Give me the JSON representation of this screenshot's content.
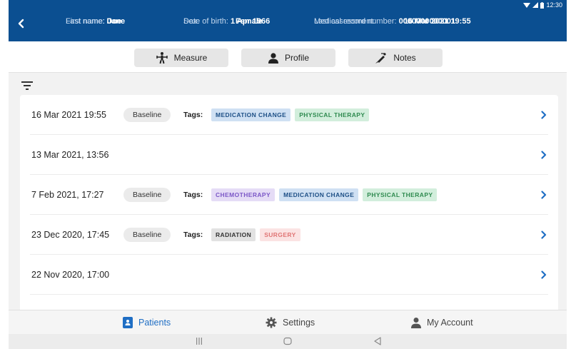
{
  "patient": {
    "first_name_label": "First name:",
    "first_name": "Jane",
    "last_name_label": "Last name:",
    "last_name": "Doe",
    "dob_label": "Date of birth:",
    "dob": "1 Apr 1966",
    "sex_label": "Sex:",
    "sex": "Female",
    "mrn_label": "Medical record number:",
    "mrn": "0000000000001",
    "last_assessment_label": "Last assessment:",
    "last_assessment": "16 Mar 2021 19:55"
  },
  "status_bar": {
    "time": "12:30"
  },
  "tabs": {
    "measure": "Measure",
    "profile": "Profile",
    "notes": "Notes"
  },
  "tags_label": "Tags:",
  "baseline_label": "Baseline",
  "assessments": [
    {
      "date": "16 Mar 2021 19:55",
      "baseline": true,
      "tags": [
        "MEDICATION CHANGE",
        "PHYSICAL THERAPY"
      ]
    },
    {
      "date": "13 Mar 2021, 13:56",
      "baseline": false,
      "tags": []
    },
    {
      "date": "7 Feb 2021, 17:27",
      "baseline": true,
      "tags": [
        "CHEMOTHERAPY",
        "MEDICATION CHANGE",
        "PHYSICAL THERAPY"
      ]
    },
    {
      "date": "23 Dec 2020, 17:45",
      "baseline": true,
      "tags": [
        "RADIATION",
        "SURGERY"
      ]
    },
    {
      "date": "22 Nov 2020, 17:00",
      "baseline": false,
      "tags": []
    }
  ],
  "tag_colors": {
    "MEDICATION CHANGE": {
      "bg": "#cfe0f3",
      "fg": "#1d4f86"
    },
    "PHYSICAL THERAPY": {
      "bg": "#d2eedc",
      "fg": "#2e8a4f"
    },
    "CHEMOTHERAPY": {
      "bg": "#e5dcf6",
      "fg": "#7b57c7"
    },
    "RADIATION": {
      "bg": "#e2e2e2",
      "fg": "#333333"
    },
    "SURGERY": {
      "bg": "#fbe3e3",
      "fg": "#e07474"
    }
  },
  "bottom_nav": {
    "patients": "Patients",
    "settings": "Settings",
    "account": "My Account"
  },
  "colors": {
    "header": "#0b4f91",
    "accent": "#1f6ec4"
  }
}
